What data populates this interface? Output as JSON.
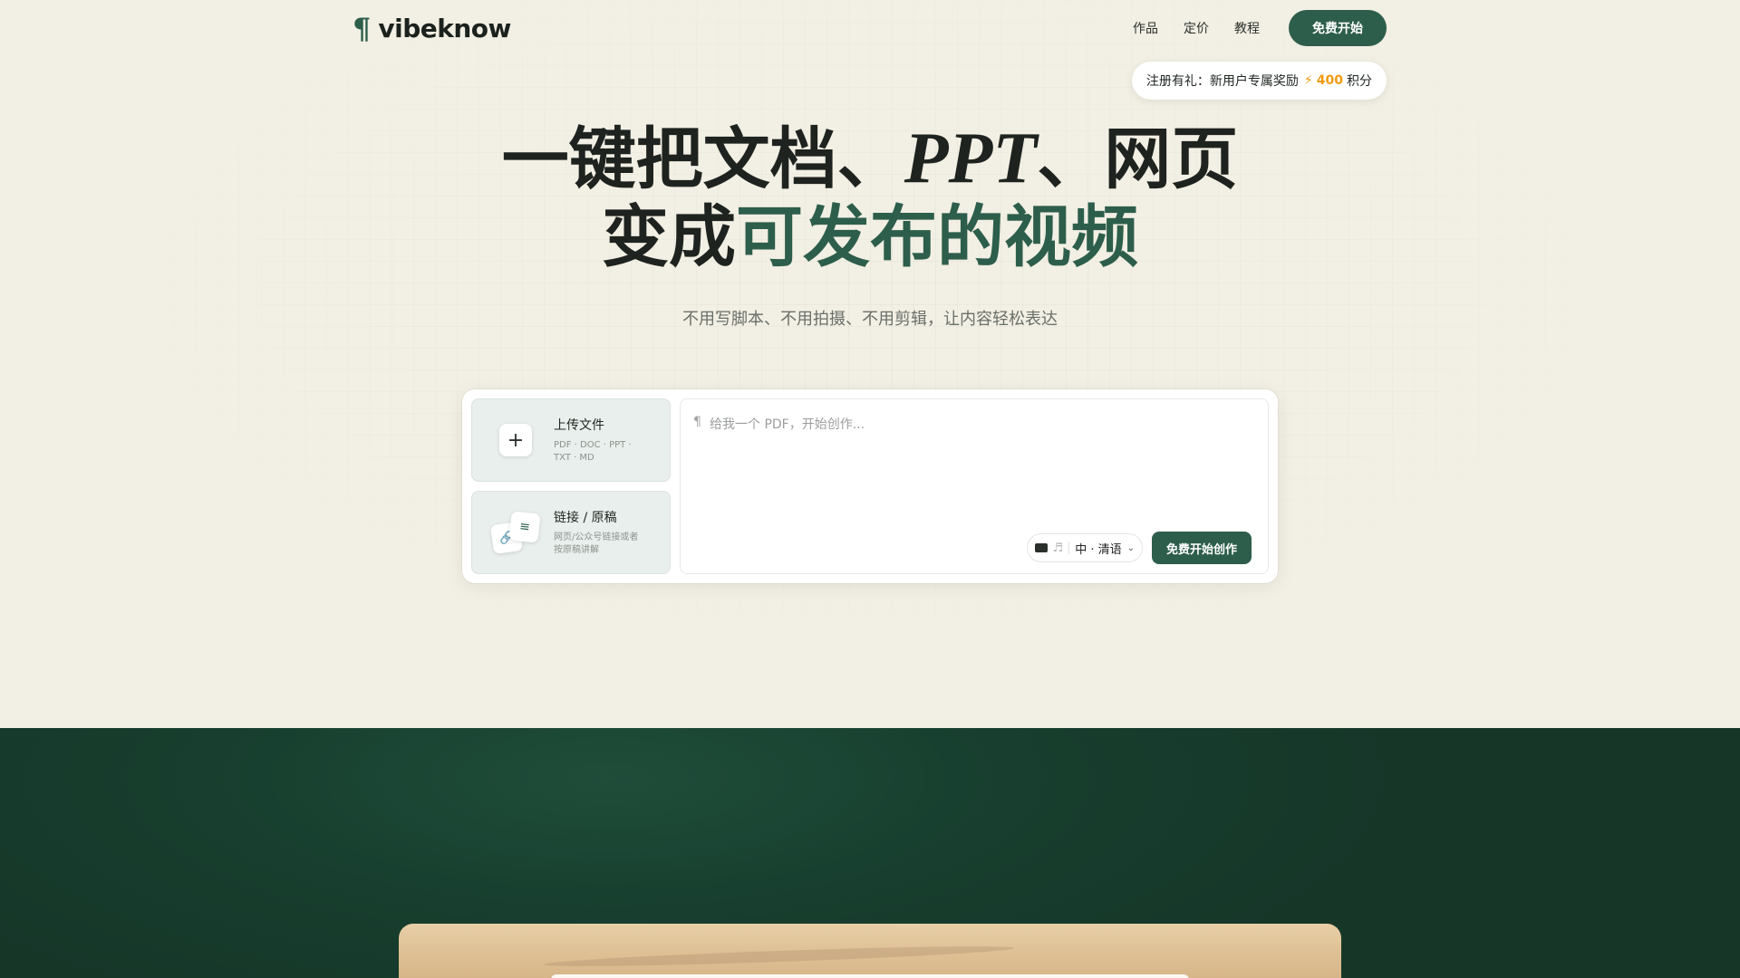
{
  "header": {
    "logo_mark": "¶",
    "logo_text": "vibeknow",
    "nav": [
      {
        "label": "作品"
      },
      {
        "label": "定价"
      },
      {
        "label": "教程"
      }
    ],
    "cta_label": "免费开始"
  },
  "promo": {
    "prefix": "注册有礼：新用户专属奖励",
    "points": "400",
    "suffix": "积分"
  },
  "hero": {
    "line1_a": "一键把文档、",
    "line1_italic": "PPT",
    "line1_b": "、网页",
    "line2_a": "变成",
    "line2_green": "可发布的视频",
    "subtitle": "不用写脚本、不用拍摄、不用剪辑，让内容轻松表达"
  },
  "creator": {
    "upload": {
      "title": "上传文件",
      "subtitle": "PDF · DOC · PPT · TXT · MD"
    },
    "link": {
      "title": "链接 / 原稿",
      "subtitle": "网页/公众号链接或者按原稿讲解"
    },
    "input": {
      "placeholder": "给我一个 PDF，开始创作..."
    },
    "language": "中 · 清语",
    "start_label": "免费开始创作"
  },
  "colors": {
    "brand_green": "#2d5e4b",
    "accent_orange": "#f29a13",
    "background": "#f2efe4",
    "dark_section": "#173e2e"
  },
  "icons": {
    "plus": "plus-icon",
    "link": "link-icon",
    "document": "document-icon",
    "screen": "screen-icon",
    "music": "music-icon",
    "bolt": "bolt-icon",
    "chevron": "chevron-down-icon"
  }
}
